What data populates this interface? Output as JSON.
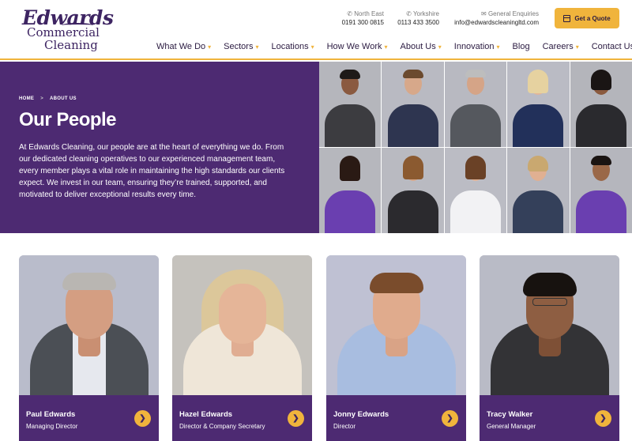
{
  "brand": {
    "line1": "Edwards",
    "line2": "Commercial",
    "line3": "Cleaning",
    "purple": "#4d2a72",
    "gold": "#f0b43c"
  },
  "contacts": [
    {
      "icon": "phone-icon",
      "label": "North East",
      "value": "0191 300 0815"
    },
    {
      "icon": "phone-icon",
      "label": "Yorkshire",
      "value": "0113 433 3500"
    },
    {
      "icon": "mail-icon",
      "label": "General Enquiries",
      "value": "info@edwardscleaningltd.com"
    }
  ],
  "quote_button": {
    "label": "Get a Quote",
    "icon": "calendar-icon"
  },
  "nav": [
    {
      "label": "What We Do",
      "dropdown": true
    },
    {
      "label": "Sectors",
      "dropdown": true
    },
    {
      "label": "Locations",
      "dropdown": true
    },
    {
      "label": "How We Work",
      "dropdown": true
    },
    {
      "label": "About Us",
      "dropdown": true
    },
    {
      "label": "Innovation",
      "dropdown": true
    },
    {
      "label": "Blog",
      "dropdown": false
    },
    {
      "label": "Careers",
      "dropdown": true
    },
    {
      "label": "Contact Us",
      "dropdown": false
    }
  ],
  "hero": {
    "breadcrumb": {
      "home": "HOME",
      "separator": ">",
      "current": "ABOUT US"
    },
    "title": "Our People",
    "intro": "At Edwards Cleaning, our people are at the heart of everything we do. From our dedicated cleaning operatives to our experienced management team, every member plays a vital role in maintaining the high standards our clients expect. We invest in our team, ensuring they’re trained, supported, and motivated to deliver exceptional results every time."
  },
  "team": [
    {
      "name": "Paul Edwards",
      "role": "Managing Director"
    },
    {
      "name": "Hazel Edwards",
      "role": "Director & Company Secretary"
    },
    {
      "name": "Jonny Edwards",
      "role": "Director"
    },
    {
      "name": "Tracy Walker",
      "role": "General Manager"
    }
  ]
}
